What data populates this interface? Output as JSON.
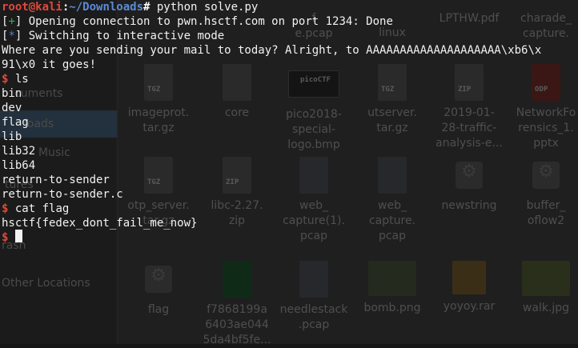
{
  "file_manager": {
    "sidebar": [
      {
        "label": "cuments"
      },
      {
        "label": "loads",
        "active": true
      },
      {
        "label": "Music"
      },
      {
        "label": "tures"
      },
      {
        "label": "rash"
      },
      {
        "label": "Other Locations"
      }
    ],
    "files": [
      {
        "name_lines": [
          "f",
          "e.pcap"
        ],
        "icon": "file-icon"
      },
      {
        "name_lines": [
          "linux"
        ],
        "icon": "file-icon"
      },
      {
        "name_lines": [
          "LPTHW.pdf"
        ],
        "icon": "file-icon"
      },
      {
        "name_lines": [
          "charade_",
          "capture."
        ],
        "icon": "file-icon"
      },
      {
        "name_lines": [
          "imageprot.",
          "tar.gz"
        ],
        "icon": "archive-icon",
        "tag": "TGZ"
      },
      {
        "name_lines": [
          "core"
        ],
        "icon": "document-icon"
      },
      {
        "name_lines": [
          "pico2018-",
          "special-",
          "logo.bmp"
        ],
        "icon": "image-icon",
        "tag": "picoCTF"
      },
      {
        "name_lines": [
          "utserver.",
          "tar.gz"
        ],
        "icon": "archive-icon",
        "tag": "TGZ"
      },
      {
        "name_lines": [
          "2019-01-",
          "28-traffic-",
          "analysis-e..."
        ],
        "icon": "archive-icon",
        "tag": "ZIP"
      },
      {
        "name_lines": [
          "NetworkFo",
          "rensics_1.",
          "pptx"
        ],
        "icon": "presentation-icon",
        "tag": "ODP"
      },
      {
        "name_lines": [
          "otp_server.",
          "tar.gz"
        ],
        "icon": "archive-icon",
        "tag": "TGZ"
      },
      {
        "name_lines": [
          "libc-2.27.",
          "zip"
        ],
        "icon": "archive-icon",
        "tag": "ZIP"
      },
      {
        "name_lines": [
          "web_",
          "capture(1).",
          "pcap"
        ],
        "icon": "binary-icon"
      },
      {
        "name_lines": [
          "web_",
          "capture.",
          "pcap"
        ],
        "icon": "binary-icon"
      },
      {
        "name_lines": [
          "newstring"
        ],
        "icon": "gear-icon"
      },
      {
        "name_lines": [
          "buffer_",
          "oflow2"
        ],
        "icon": "gear-icon"
      },
      {
        "name_lines": [
          "flag"
        ],
        "icon": "gear-icon"
      },
      {
        "name_lines": [
          "f7868199a",
          "6403ae044",
          "5da4bf5fe..."
        ],
        "icon": "spreadsheet-icon"
      },
      {
        "name_lines": [
          "needlestack",
          ".pcap"
        ],
        "icon": "binary-icon"
      },
      {
        "name_lines": [
          "bomb.png"
        ],
        "icon": "image-icon"
      },
      {
        "name_lines": [
          "yoyoy.rar"
        ],
        "icon": "archive-icon"
      },
      {
        "name_lines": [
          "walk.jpg"
        ],
        "icon": "image-icon"
      }
    ]
  },
  "terminal": {
    "prompt_user": "root@kali",
    "prompt_sep": ":",
    "prompt_path": "~/Downloads",
    "prompt_hash": "#",
    "command1": " python solve.py",
    "lines": [
      {
        "bracket_open": "[",
        "mark": "+",
        "bracket_close": "]",
        "text": " Opening connection to pwn.hsctf.com on port 1234: Done"
      },
      {
        "bracket_open": "[",
        "mark": "*",
        "bracket_close": "]",
        "text": " Switching to interactive mode"
      }
    ],
    "output_line1": "Where are you sending your mail to today? Alright, to AAAAAAAAAAAAAAAAAAAA\\xb6\\x",
    "output_line2": "91\\x0 it goes!",
    "shell_prompt": "$",
    "cmd_ls": " ls",
    "ls_output": [
      "bin",
      "dev",
      "flag",
      "lib",
      "lib32",
      "lib64",
      "return-to-sender",
      "return-to-sender.c"
    ],
    "cmd_cat": " cat flag",
    "flag_output": "hsctf{fedex_dont_fail_me_now}",
    "final_prompt": "$"
  }
}
